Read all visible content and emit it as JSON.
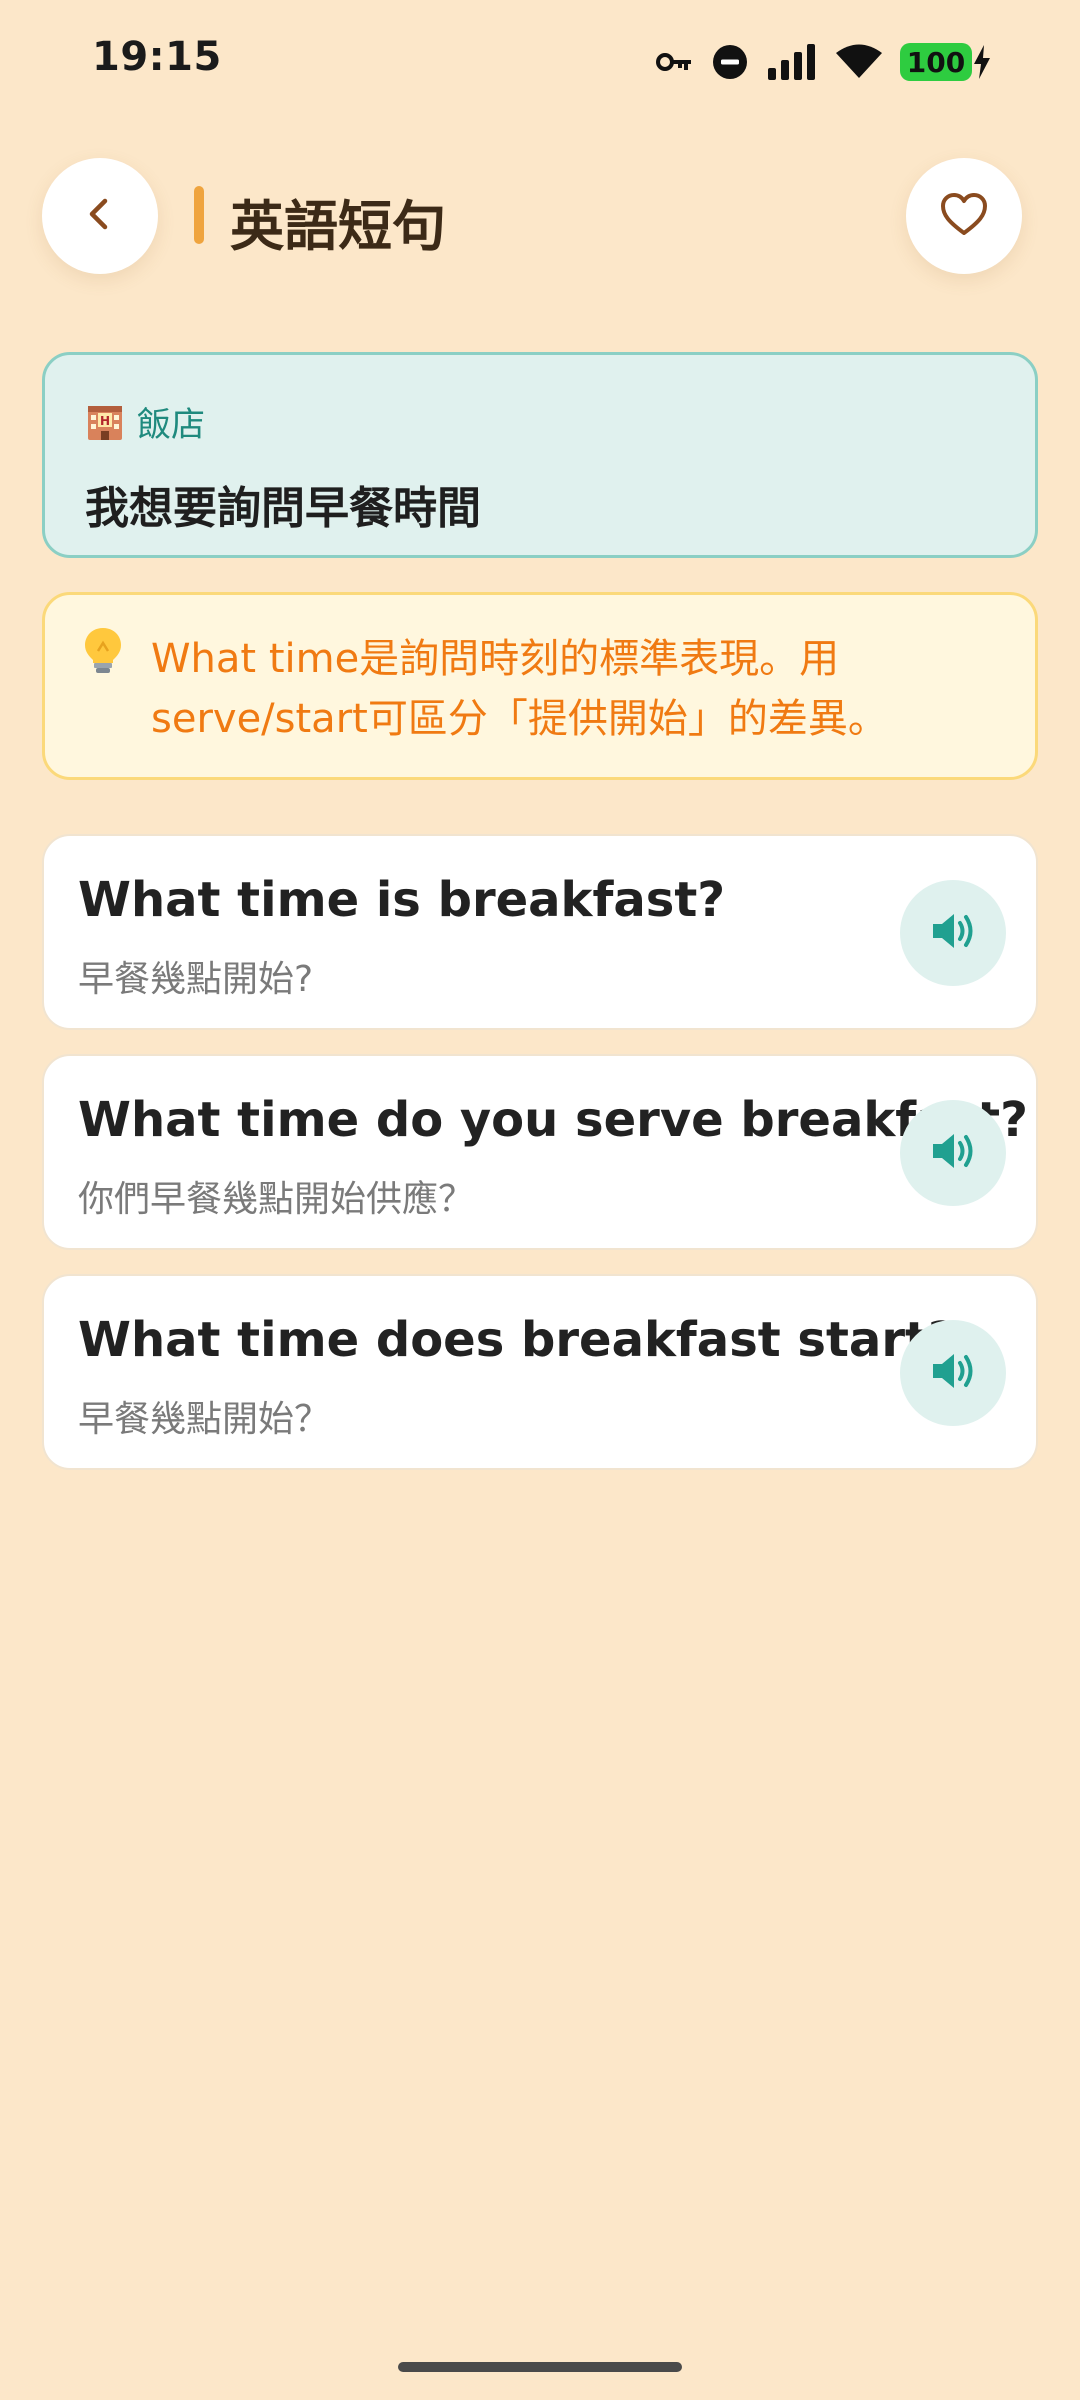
{
  "status_bar": {
    "time": "19:15",
    "battery": "100",
    "icons": [
      "vpn-key-icon",
      "dnd-icon",
      "signal-icon",
      "wifi-icon",
      "battery-icon",
      "charging-icon"
    ]
  },
  "header": {
    "title": "英語短句",
    "back_icon": "chevron-left-icon",
    "favorite_icon": "heart-outline-icon"
  },
  "category": {
    "icon": "hotel-icon",
    "name": "飯店",
    "phrase": "我想要詢問早餐時間"
  },
  "tip": {
    "icon": "lightbulb-icon",
    "text": "What time是詢問時刻的標準表現。用serve/start可區分「提供開始」的差異。"
  },
  "phrases": [
    {
      "en": "What time is breakfast?",
      "zh": "早餐幾點開始?"
    },
    {
      "en": "What time do you serve breakfast?",
      "zh": "你們早餐幾點開始供應？"
    },
    {
      "en": "What time does breakfast start?",
      "zh": "早餐幾點開始？"
    }
  ],
  "colors": {
    "background": "#FCE7C9",
    "accent_orange": "#EFA43E",
    "teal": "#1F8A7E",
    "tip_text": "#F07A12"
  }
}
